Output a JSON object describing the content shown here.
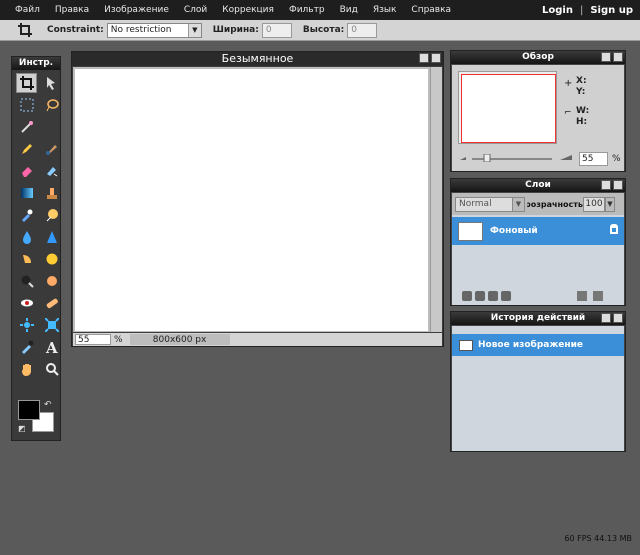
{
  "menubar": {
    "items": [
      "Файл",
      "Правка",
      "Изображение",
      "Слой",
      "Коррекция",
      "Фильтр",
      "Вид",
      "Язык",
      "Справка"
    ],
    "login": "Login",
    "separator": "|",
    "signup": "Sign up"
  },
  "optionsbar": {
    "constraint_label": "Constraint:",
    "constraint_value": "No restriction",
    "width_label": "Ширина:",
    "width_value": "0",
    "height_label": "Высота:",
    "height_value": "0"
  },
  "tools": {
    "title": "Инстр.",
    "items": [
      "crop",
      "move",
      "marquee",
      "lasso",
      "magic-wand",
      "pencil",
      "brush",
      "eraser",
      "replace-color",
      "gradient",
      "stamp",
      "color-replace",
      "sponge",
      "drop",
      "sharpen",
      "smudge",
      "blob",
      "burn",
      "dodge",
      "red-eye",
      "spot-heal",
      "bloat",
      "pinch",
      "color-picker",
      "type",
      "hand",
      "zoom"
    ],
    "foreground_color": "#000000",
    "background_color": "#ffffff"
  },
  "canvas": {
    "title": "Безымянное",
    "zoom": "55",
    "zoom_unit": "%",
    "size": "800x600 px"
  },
  "overview": {
    "title": "Обзор",
    "x_label": "X:",
    "y_label": "Y:",
    "w_label": "W:",
    "h_label": "H:",
    "zoom": "55",
    "zoom_unit": "%"
  },
  "layers": {
    "title": "Слои",
    "blend_mode": "Normal",
    "opacity_label": "Непрозрачность:",
    "opacity_value": "100",
    "items": [
      {
        "name": "Фоновый"
      }
    ]
  },
  "history": {
    "title": "История действий",
    "items": [
      {
        "label": "Новое изображение"
      }
    ]
  },
  "status": {
    "fps": "60 FPS 44.13 MB"
  },
  "colors": {
    "accent": "#3b8fd8",
    "selection_border": "#ee3333"
  }
}
